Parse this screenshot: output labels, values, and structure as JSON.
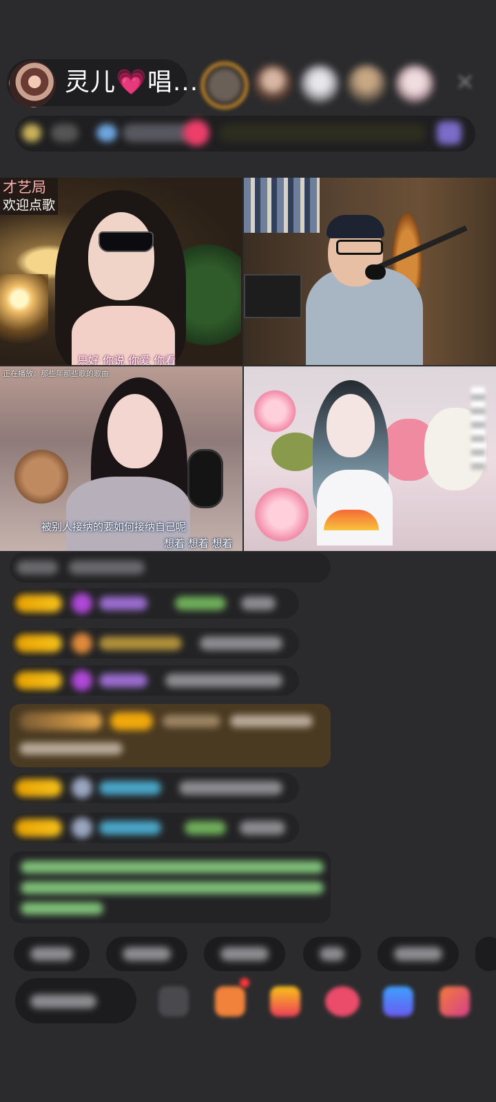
{
  "host": {
    "name": "灵儿💗唱..."
  },
  "tiles": {
    "t1": {
      "stamp_line1": "才艺局",
      "stamp_line2": "欢迎点歌",
      "caption": "只好 你说 你爱 你看"
    },
    "t3": {
      "caption_top": "正在播放：那些年那些歌的歌曲",
      "caption_main": "被别人接纳的要如何接纳自己呢",
      "caption_sub": "想着 想着 想着"
    }
  },
  "colors": {
    "background": "#2b2b2d",
    "badge": "#f2b10c",
    "gift_highlight": "#4a3a22",
    "notice_text": "#8cd18a",
    "nick_blue": "#4aa6c8"
  },
  "icons": [
    "close-icon",
    "emoji-icon",
    "gift-icon",
    "game-icon",
    "heart-icon",
    "share-icon",
    "more-icon"
  ]
}
